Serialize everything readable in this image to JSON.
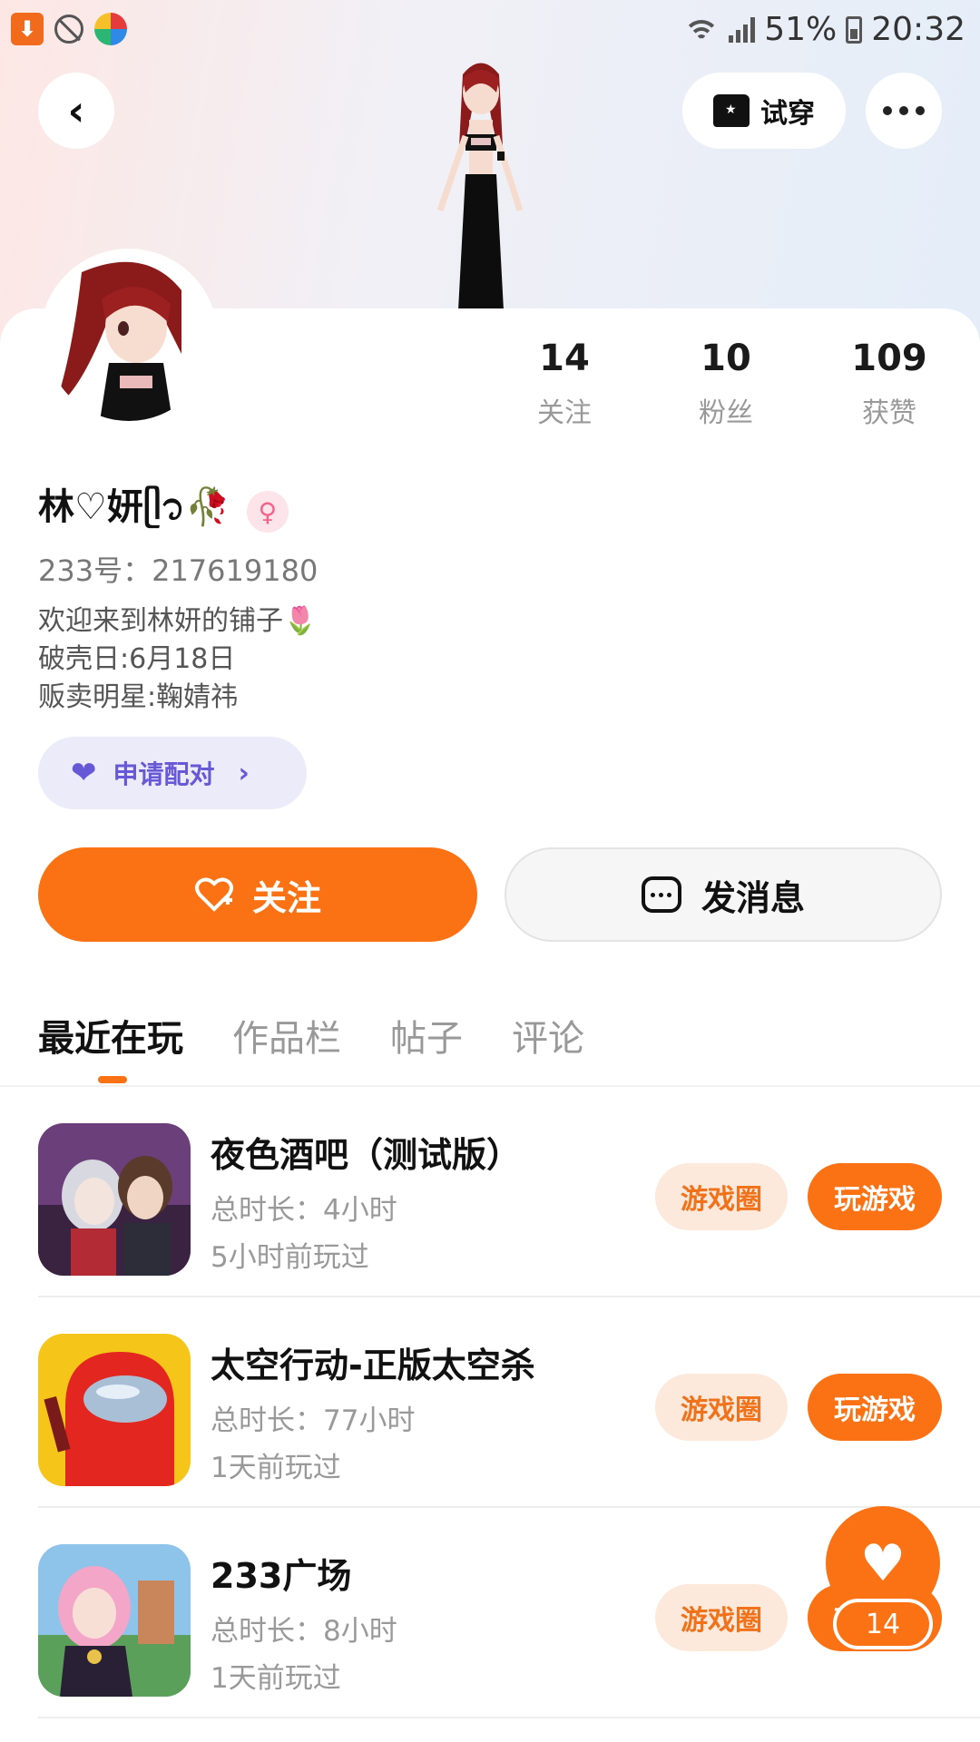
{
  "status_bar": {
    "battery": "51%",
    "time": "20:32"
  },
  "header": {
    "tryon_label": "试穿"
  },
  "stats": [
    {
      "value": "14",
      "label": "关注"
    },
    {
      "value": "10",
      "label": "粉丝"
    },
    {
      "value": "109",
      "label": "获赞"
    }
  ],
  "profile": {
    "name": "林♡妍ᥫ᭡🥀",
    "gender_symbol": "♀",
    "uid": "233号：217619180",
    "bio": [
      "欢迎来到林妍的铺子🌷",
      "破壳日:6月18日",
      "贩卖明星:鞠婧祎"
    ]
  },
  "pair_button": {
    "label": "申请配对"
  },
  "actions": {
    "follow_label": "关注",
    "message_label": "发消息"
  },
  "tabs": [
    "最近在玩",
    "作品栏",
    "帖子",
    "评论"
  ],
  "games": [
    {
      "title": "夜色酒吧（测试版）",
      "duration": "总时长：4小时",
      "last_played": "5小时前玩过",
      "circle_label": "游戏圈",
      "play_label": "玩游戏"
    },
    {
      "title": "太空行动-正版太空杀",
      "duration": "总时长：77小时",
      "last_played": "1天前玩过",
      "circle_label": "游戏圈",
      "play_label": "玩游戏"
    },
    {
      "title": "233广场",
      "duration": "总时长：8小时",
      "last_played": "1天前玩过",
      "circle_label": "游戏圈",
      "play_label": "玩游戏"
    }
  ],
  "like_fab": {
    "count": "14"
  },
  "colors": {
    "accent": "#fa7214",
    "pair_purple": "#6658d6"
  }
}
